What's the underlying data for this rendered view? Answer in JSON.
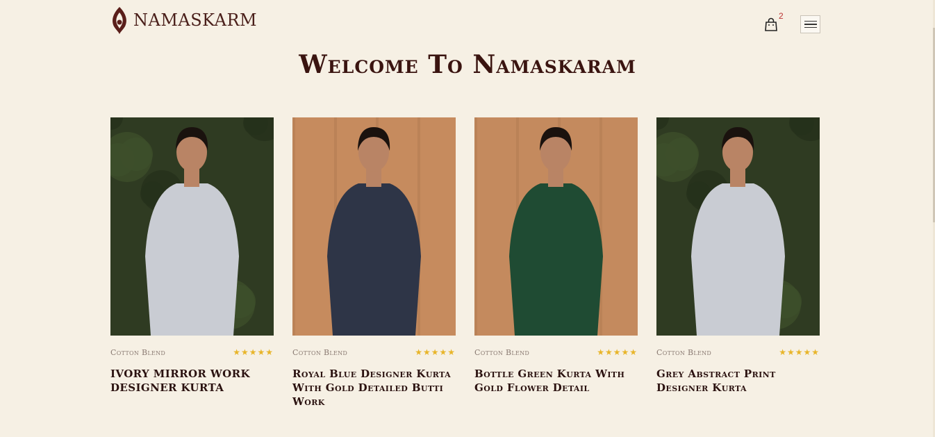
{
  "brand": {
    "name": "NAMASKARM",
    "accent": "#5a1e1a"
  },
  "header": {
    "cart_count": "2"
  },
  "page_title": "Welcome To Namaskaram",
  "products": [
    {
      "fabric": "Cotton Blend",
      "rating": "★★★★★",
      "name": "IVORY MIRROR WORK DESIGNER KURTA",
      "image": "ivory-kurta",
      "color": "#c9ccd3",
      "bg": "#2f3b22"
    },
    {
      "fabric": "Cotton Blend",
      "rating": "★★★★★",
      "name": "Royal Blue Designer Kurta With Gold Detailed Butti Work",
      "image": "royal-blue-kurta",
      "color": "#2e3547",
      "bg": "#c68b5e"
    },
    {
      "fabric": "Cotton Blend",
      "rating": "★★★★★",
      "name": "Bottle Green Kurta With Gold Flower Detail",
      "image": "bottle-green-kurta",
      "color": "#1f4b33",
      "bg": "#c48a5e"
    },
    {
      "fabric": "Cotton Blend",
      "rating": "★★★★★",
      "name": "Grey Abstract Print Designer Kurta",
      "image": "grey-abstract-kurta",
      "color": "#c9ccd3",
      "bg": "#2f3b22"
    }
  ]
}
